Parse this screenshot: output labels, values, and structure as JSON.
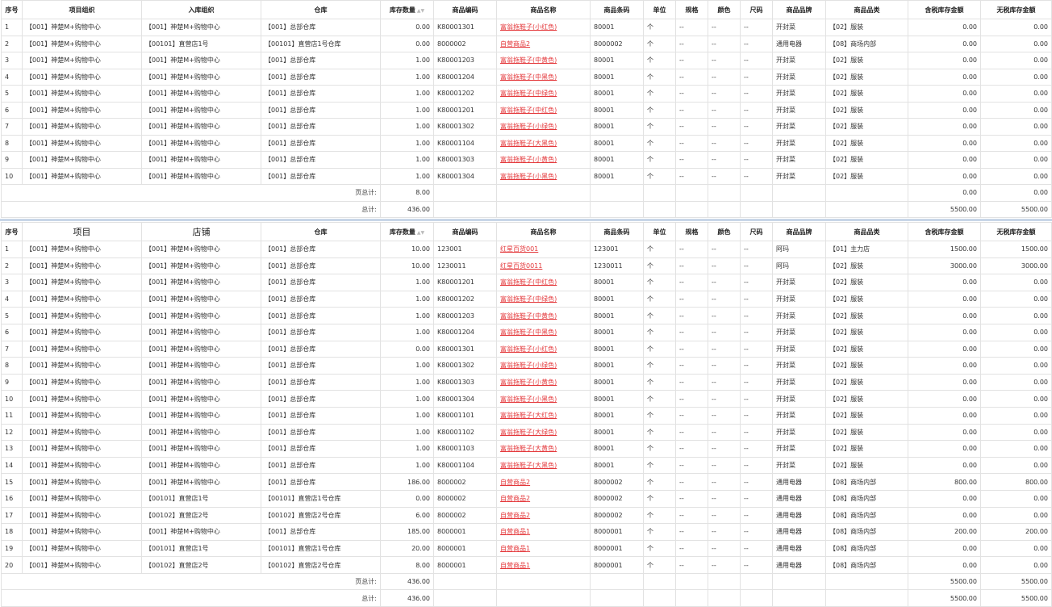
{
  "colors": {
    "link": "#e4393c",
    "border": "#e2e2e2",
    "divider": "#c8d6e8"
  },
  "table1": {
    "headers": [
      "序号",
      "项目组织",
      "入库组织",
      "仓库",
      "库存数量",
      "商品编码",
      "商品名称",
      "商品条码",
      "单位",
      "规格",
      "颜色",
      "尺码",
      "商品品牌",
      "商品品类",
      "含税库存金额",
      "无税库存金额"
    ],
    "rows": [
      [
        "1",
        "【001】神楚M+购物中心",
        "【001】神楚M+购物中心",
        "【001】总部仓库",
        "0.00",
        "K80001301",
        "富翁拖鞋子(小红色)",
        "80001",
        "个",
        "--",
        "--",
        "--",
        "开封菜",
        "【02】服装",
        "0.00",
        "0.00"
      ],
      [
        "2",
        "【001】神楚M+购物中心",
        "【00101】直营店1号",
        "【00101】直营店1号仓库",
        "0.00",
        "8000002",
        "自营商品2",
        "8000002",
        "个",
        "--",
        "--",
        "--",
        "通用电器",
        "【08】商场内部",
        "0.00",
        "0.00"
      ],
      [
        "3",
        "【001】神楚M+购物中心",
        "【001】神楚M+购物中心",
        "【001】总部仓库",
        "1.00",
        "K80001203",
        "富翁拖鞋子(中黄色)",
        "80001",
        "个",
        "--",
        "--",
        "--",
        "开封菜",
        "【02】服装",
        "0.00",
        "0.00"
      ],
      [
        "4",
        "【001】神楚M+购物中心",
        "【001】神楚M+购物中心",
        "【001】总部仓库",
        "1.00",
        "K80001204",
        "富翁拖鞋子(中黑色)",
        "80001",
        "个",
        "--",
        "--",
        "--",
        "开封菜",
        "【02】服装",
        "0.00",
        "0.00"
      ],
      [
        "5",
        "【001】神楚M+购物中心",
        "【001】神楚M+购物中心",
        "【001】总部仓库",
        "1.00",
        "K80001202",
        "富翁拖鞋子(中绿色)",
        "80001",
        "个",
        "--",
        "--",
        "--",
        "开封菜",
        "【02】服装",
        "0.00",
        "0.00"
      ],
      [
        "6",
        "【001】神楚M+购物中心",
        "【001】神楚M+购物中心",
        "【001】总部仓库",
        "1.00",
        "K80001201",
        "富翁拖鞋子(中红色)",
        "80001",
        "个",
        "--",
        "--",
        "--",
        "开封菜",
        "【02】服装",
        "0.00",
        "0.00"
      ],
      [
        "7",
        "【001】神楚M+购物中心",
        "【001】神楚M+购物中心",
        "【001】总部仓库",
        "1.00",
        "K80001302",
        "富翁拖鞋子(小绿色)",
        "80001",
        "个",
        "--",
        "--",
        "--",
        "开封菜",
        "【02】服装",
        "0.00",
        "0.00"
      ],
      [
        "8",
        "【001】神楚M+购物中心",
        "【001】神楚M+购物中心",
        "【001】总部仓库",
        "1.00",
        "K80001104",
        "富翁拖鞋子(大黑色)",
        "80001",
        "个",
        "--",
        "--",
        "--",
        "开封菜",
        "【02】服装",
        "0.00",
        "0.00"
      ],
      [
        "9",
        "【001】神楚M+购物中心",
        "【001】神楚M+购物中心",
        "【001】总部仓库",
        "1.00",
        "K80001303",
        "富翁拖鞋子(小黄色)",
        "80001",
        "个",
        "--",
        "--",
        "--",
        "开封菜",
        "【02】服装",
        "0.00",
        "0.00"
      ],
      [
        "10",
        "【001】神楚M+购物中心",
        "【001】神楚M+购物中心",
        "【001】总部仓库",
        "1.00",
        "K80001304",
        "富翁拖鞋子(小黑色)",
        "80001",
        "个",
        "--",
        "--",
        "--",
        "开封菜",
        "【02】服装",
        "0.00",
        "0.00"
      ]
    ],
    "page_total": {
      "label": "页总计:",
      "qty": "8.00",
      "tax": "0.00",
      "notax": "0.00"
    },
    "grand_total": {
      "label": "总计:",
      "qty": "436.00",
      "tax": "5500.00",
      "notax": "5500.00"
    }
  },
  "table2": {
    "headers": [
      "序号",
      "项目",
      "店铺",
      "仓库",
      "库存数量",
      "商品编码",
      "商品名称",
      "商品条码",
      "单位",
      "规格",
      "颜色",
      "尺码",
      "商品品牌",
      "商品品类",
      "含税库存金额",
      "无税库存金额"
    ],
    "rows": [
      [
        "1",
        "【001】神楚M+购物中心",
        "【001】神楚M+购物中心",
        "【001】总部仓库",
        "10.00",
        "123001",
        "红星百货001",
        "123001",
        "个",
        "--",
        "--",
        "--",
        "阿玛",
        "【01】主力店",
        "1500.00",
        "1500.00"
      ],
      [
        "2",
        "【001】神楚M+购物中心",
        "【001】神楚M+购物中心",
        "【001】总部仓库",
        "10.00",
        "1230011",
        "红星百货0011",
        "1230011",
        "个",
        "--",
        "--",
        "--",
        "阿玛",
        "【02】服装",
        "3000.00",
        "3000.00"
      ],
      [
        "3",
        "【001】神楚M+购物中心",
        "【001】神楚M+购物中心",
        "【001】总部仓库",
        "1.00",
        "K80001201",
        "富翁拖鞋子(中红色)",
        "80001",
        "个",
        "--",
        "--",
        "--",
        "开封菜",
        "【02】服装",
        "0.00",
        "0.00"
      ],
      [
        "4",
        "【001】神楚M+购物中心",
        "【001】神楚M+购物中心",
        "【001】总部仓库",
        "1.00",
        "K80001202",
        "富翁拖鞋子(中绿色)",
        "80001",
        "个",
        "--",
        "--",
        "--",
        "开封菜",
        "【02】服装",
        "0.00",
        "0.00"
      ],
      [
        "5",
        "【001】神楚M+购物中心",
        "【001】神楚M+购物中心",
        "【001】总部仓库",
        "1.00",
        "K80001203",
        "富翁拖鞋子(中黄色)",
        "80001",
        "个",
        "--",
        "--",
        "--",
        "开封菜",
        "【02】服装",
        "0.00",
        "0.00"
      ],
      [
        "6",
        "【001】神楚M+购物中心",
        "【001】神楚M+购物中心",
        "【001】总部仓库",
        "1.00",
        "K80001204",
        "富翁拖鞋子(中黑色)",
        "80001",
        "个",
        "--",
        "--",
        "--",
        "开封菜",
        "【02】服装",
        "0.00",
        "0.00"
      ],
      [
        "7",
        "【001】神楚M+购物中心",
        "【001】神楚M+购物中心",
        "【001】总部仓库",
        "0.00",
        "K80001301",
        "富翁拖鞋子(小红色)",
        "80001",
        "个",
        "--",
        "--",
        "--",
        "开封菜",
        "【02】服装",
        "0.00",
        "0.00"
      ],
      [
        "8",
        "【001】神楚M+购物中心",
        "【001】神楚M+购物中心",
        "【001】总部仓库",
        "1.00",
        "K80001302",
        "富翁拖鞋子(小绿色)",
        "80001",
        "个",
        "--",
        "--",
        "--",
        "开封菜",
        "【02】服装",
        "0.00",
        "0.00"
      ],
      [
        "9",
        "【001】神楚M+购物中心",
        "【001】神楚M+购物中心",
        "【001】总部仓库",
        "1.00",
        "K80001303",
        "富翁拖鞋子(小黄色)",
        "80001",
        "个",
        "--",
        "--",
        "--",
        "开封菜",
        "【02】服装",
        "0.00",
        "0.00"
      ],
      [
        "10",
        "【001】神楚M+购物中心",
        "【001】神楚M+购物中心",
        "【001】总部仓库",
        "1.00",
        "K80001304",
        "富翁拖鞋子(小黑色)",
        "80001",
        "个",
        "--",
        "--",
        "--",
        "开封菜",
        "【02】服装",
        "0.00",
        "0.00"
      ],
      [
        "11",
        "【001】神楚M+购物中心",
        "【001】神楚M+购物中心",
        "【001】总部仓库",
        "1.00",
        "K80001101",
        "富翁拖鞋子(大红色)",
        "80001",
        "个",
        "--",
        "--",
        "--",
        "开封菜",
        "【02】服装",
        "0.00",
        "0.00"
      ],
      [
        "12",
        "【001】神楚M+购物中心",
        "【001】神楚M+购物中心",
        "【001】总部仓库",
        "1.00",
        "K80001102",
        "富翁拖鞋子(大绿色)",
        "80001",
        "个",
        "--",
        "--",
        "--",
        "开封菜",
        "【02】服装",
        "0.00",
        "0.00"
      ],
      [
        "13",
        "【001】神楚M+购物中心",
        "【001】神楚M+购物中心",
        "【001】总部仓库",
        "1.00",
        "K80001103",
        "富翁拖鞋子(大黄色)",
        "80001",
        "个",
        "--",
        "--",
        "--",
        "开封菜",
        "【02】服装",
        "0.00",
        "0.00"
      ],
      [
        "14",
        "【001】神楚M+购物中心",
        "【001】神楚M+购物中心",
        "【001】总部仓库",
        "1.00",
        "K80001104",
        "富翁拖鞋子(大黑色)",
        "80001",
        "个",
        "--",
        "--",
        "--",
        "开封菜",
        "【02】服装",
        "0.00",
        "0.00"
      ],
      [
        "15",
        "【001】神楚M+购物中心",
        "【001】神楚M+购物中心",
        "【001】总部仓库",
        "186.00",
        "8000002",
        "自营商品2",
        "8000002",
        "个",
        "--",
        "--",
        "--",
        "通用电器",
        "【08】商场内部",
        "800.00",
        "800.00"
      ],
      [
        "16",
        "【001】神楚M+购物中心",
        "【00101】直营店1号",
        "【00101】直营店1号仓库",
        "0.00",
        "8000002",
        "自营商品2",
        "8000002",
        "个",
        "--",
        "--",
        "--",
        "通用电器",
        "【08】商场内部",
        "0.00",
        "0.00"
      ],
      [
        "17",
        "【001】神楚M+购物中心",
        "【00102】直营店2号",
        "【00102】直营店2号仓库",
        "6.00",
        "8000002",
        "自营商品2",
        "8000002",
        "个",
        "--",
        "--",
        "--",
        "通用电器",
        "【08】商场内部",
        "0.00",
        "0.00"
      ],
      [
        "18",
        "【001】神楚M+购物中心",
        "【001】神楚M+购物中心",
        "【001】总部仓库",
        "185.00",
        "8000001",
        "自营商品1",
        "8000001",
        "个",
        "--",
        "--",
        "--",
        "通用电器",
        "【08】商场内部",
        "200.00",
        "200.00"
      ],
      [
        "19",
        "【001】神楚M+购物中心",
        "【00101】直营店1号",
        "【00101】直营店1号仓库",
        "20.00",
        "8000001",
        "自营商品1",
        "8000001",
        "个",
        "--",
        "--",
        "--",
        "通用电器",
        "【08】商场内部",
        "0.00",
        "0.00"
      ],
      [
        "20",
        "【001】神楚M+购物中心",
        "【00102】直营店2号",
        "【00102】直营店2号仓库",
        "8.00",
        "8000001",
        "自营商品1",
        "8000001",
        "个",
        "--",
        "--",
        "--",
        "通用电器",
        "【08】商场内部",
        "0.00",
        "0.00"
      ]
    ],
    "page_total": {
      "label": "页总计:",
      "qty": "436.00",
      "tax": "5500.00",
      "notax": "5500.00"
    },
    "grand_total": {
      "label": "总计:",
      "qty": "436.00",
      "tax": "5500.00",
      "notax": "5500.00"
    }
  }
}
